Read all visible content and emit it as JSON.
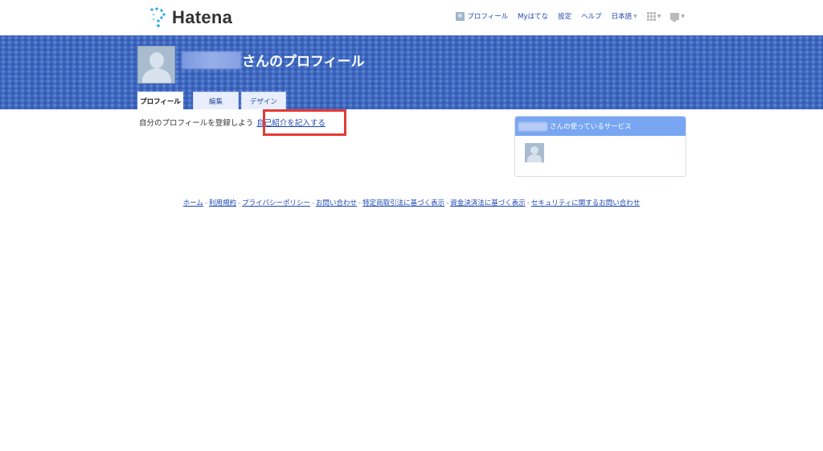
{
  "header": {
    "logo_text": "Hatena",
    "nav": {
      "profile": "プロフィール",
      "my_hatena": "Myはてな",
      "settings": "設定",
      "help": "ヘルプ",
      "language": "日本語"
    }
  },
  "banner": {
    "title": "さんのプロフィール",
    "tabs": [
      "プロフィール",
      "編集",
      "デザイン"
    ]
  },
  "main": {
    "intro_text": "自分のプロフィールを登録しよう",
    "intro_link": "自己紹介を記入する"
  },
  "side": {
    "title": "さんの使っているサービス"
  },
  "footer": {
    "links": [
      "ホーム",
      "利用規約",
      "プライバシーポリシー",
      "お問い合わせ",
      "特定商取引法に基づく表示",
      "資金決済法に基づく表示",
      "セキュリティに関するお問い合わせ"
    ]
  },
  "colors": {
    "banner": "#3f68c0",
    "link": "#1a45b8",
    "highlight": "#e53935",
    "side_header": "#79a6f2"
  }
}
